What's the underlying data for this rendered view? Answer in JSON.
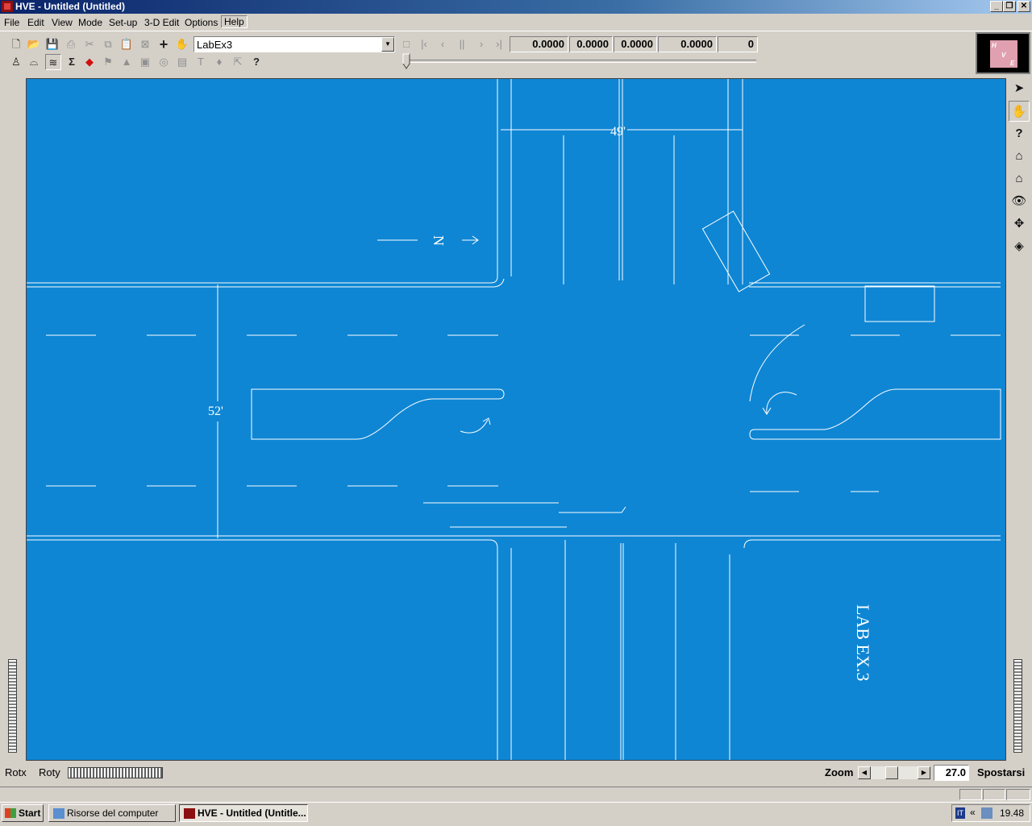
{
  "window": {
    "title": "HVE - Untitled (Untitled)",
    "caption_buttons": [
      "minimize",
      "restore",
      "close"
    ]
  },
  "menu": [
    "File",
    "Edit",
    "View",
    "Mode",
    "Set-up",
    "3-D Edit",
    "Options",
    "Help"
  ],
  "toolbar": {
    "row1_icons": [
      "new-icon",
      "open-icon",
      "save-icon",
      "print-icon",
      "cut-icon",
      "copy-icon",
      "paste-icon",
      "fit-icon",
      "add-icon",
      "hand-object-icon"
    ],
    "row2_icons": [
      "human-icon",
      "vehicle-icon",
      "environment-icon",
      "sigma-icon",
      "flip-icon",
      "flag-icon",
      "cone-icon",
      "barrel-icon",
      "target-icon",
      "box-icon",
      "text-tool-icon",
      "pin-icon",
      "arrow-tool-icon",
      "help-icon"
    ],
    "scene_name": "LabEx3",
    "playback_icons": [
      "stop-icon",
      "first-frame-icon",
      "prev-icon",
      "pause-icon",
      "next-icon",
      "last-frame-icon"
    ],
    "readouts": [
      "0.0000",
      "0.0000",
      "0.0000",
      "0.0000",
      "0"
    ]
  },
  "logo": {
    "letters": [
      "H",
      "V",
      "E"
    ]
  },
  "canvas": {
    "background": "#0e86d4",
    "line_color": "#ffffff",
    "labels": {
      "dim_top": "49'",
      "dim_left": "52'",
      "north": "N",
      "title_text": "LAB EX.3"
    }
  },
  "right_tools": [
    "select-arrow-icon",
    "pan-hand-icon",
    "query-icon",
    "home-icon",
    "home-zoom-icon",
    "eye-view-icon",
    "move-crosshair-icon",
    "3d-box-icon"
  ],
  "status": {
    "rotx": "Rotx",
    "roty": "Roty",
    "zoom_label": "Zoom",
    "zoom_value": "27.0",
    "pan_label": "Spostarsi"
  },
  "taskbar": {
    "start": "Start",
    "tasks": [
      {
        "label": "Risorse del computer",
        "active": false
      },
      {
        "label": "HVE - Untitled (Untitle...",
        "active": true
      }
    ],
    "tray_lang": "IT",
    "clock": "19.48"
  }
}
